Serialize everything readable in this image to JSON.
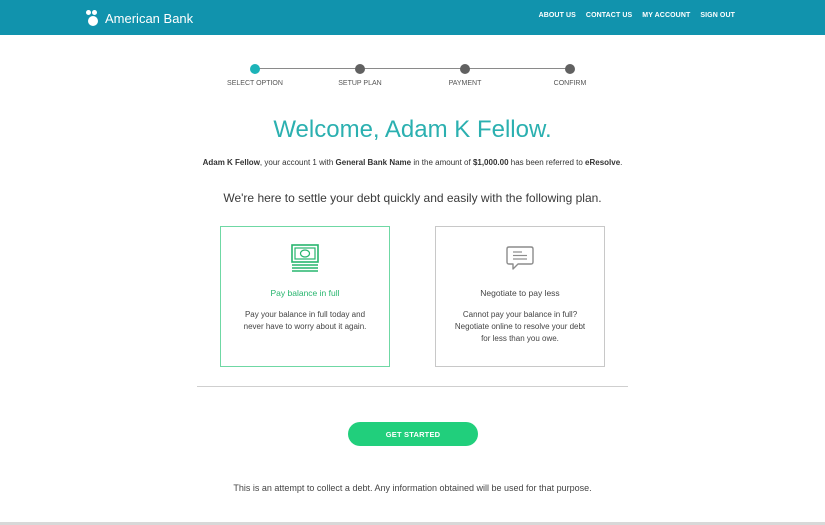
{
  "header": {
    "brand_name": "American Bank",
    "nav": [
      {
        "label": "ABOUT US"
      },
      {
        "label": "CONTACT US"
      },
      {
        "label": "MY ACCOUNT"
      },
      {
        "label": "SIGN OUT"
      }
    ]
  },
  "stepper": {
    "steps": [
      {
        "label": "SELECT OPTION",
        "active": true
      },
      {
        "label": "SETUP PLAN",
        "active": false
      },
      {
        "label": "PAYMENT",
        "active": false
      },
      {
        "label": "CONFIRM",
        "active": false
      }
    ]
  },
  "main": {
    "welcome": "Welcome, Adam K Fellow.",
    "referral": {
      "name": "Adam K Fellow",
      "text1": ", your account 1 with ",
      "bank": "General Bank Name",
      "text2": " in the amount of ",
      "amount": "$1,000.00",
      "text3": " has been referred to ",
      "agency": "eResolve",
      "text4": "."
    },
    "settle_heading": "We're here to settle your debt quickly and easily with the following plan.",
    "options": [
      {
        "icon": "money-icon",
        "title": "Pay balance in full",
        "description": "Pay your balance in full today and never have to worry about it again."
      },
      {
        "icon": "chat-bubble-icon",
        "title": "Negotiate to pay less",
        "description": "Cannot pay your balance in full? Negotiate online to resolve your debt for less than you owe."
      }
    ],
    "cta_label": "GET STARTED",
    "disclaimer": "This is an attempt to collect a debt. Any information obtained will be used for that purpose."
  },
  "colors": {
    "header_bg": "#1193ad",
    "accent_teal": "#2bb0b0",
    "active_step": "#1cb3b8",
    "accent_green": "#21cf7c",
    "option_title_green": "#27b56e"
  }
}
